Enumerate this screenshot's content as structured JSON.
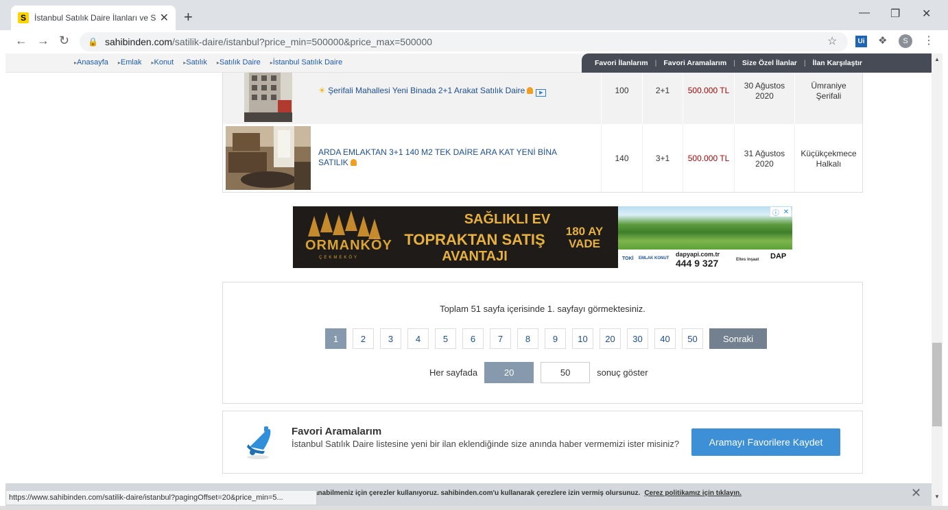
{
  "browser": {
    "tab_favicon": "S",
    "tab_title": "İstanbul Satılık Daire İlanları ve Sa",
    "tab_close": "✕",
    "new_tab": "+",
    "url_host": "sahibinden.com",
    "url_path": "/satilik-daire/istanbul?price_min=500000&price_max=500000",
    "ext_label": "Ui",
    "profile_initial": "S"
  },
  "breadcrumbs": [
    "Anasayfa",
    "Emlak",
    "Konut",
    "Satılık",
    "Satılık Daire",
    "İstanbul Satılık Daire"
  ],
  "favnav": [
    "Favori İlanlarım",
    "Favori Aramalarım",
    "Size Özel İlanlar",
    "İlan Karşılaştır"
  ],
  "listings": [
    {
      "title": "Şerifali Mahallesi Yeni Binada 2+1 Arakat Satılık Daire",
      "m2": "100",
      "rooms": "2+1",
      "price": "500.000 TL",
      "date_line1": "30 Ağustos",
      "date_line2": "2020",
      "loc_line1": "Ümraniye",
      "loc_line2": "Şerifali"
    },
    {
      "title": "ARDA EMLAKTAN 3+1 140 M2 TEK DAİRE ARA KAT YENİ BİNA SATILIK",
      "m2": "140",
      "rooms": "3+1",
      "price": "500.000 TL",
      "date_line1": "31 Ağustos",
      "date_line2": "2020",
      "loc_line1": "Küçükçekmece",
      "loc_line2": "Halkalı"
    }
  ],
  "ad": {
    "brand": "ORMANKÖY",
    "brand_sub": "ÇEKMEKÖY",
    "line1": "SAĞLIKLI EV",
    "line2": "TOPRAKTAN SATIŞ",
    "line3": "AVANTAJI",
    "vade1": "180 AY",
    "vade2": "VADE",
    "toki": "TOKİ",
    "emlak_konut": "EMLAK KONUT",
    "dap_url": "dapyapi.com.tr",
    "phone": "444 9 327",
    "eltes": "Eltes inşaat",
    "dp": "DAP"
  },
  "pagination": {
    "info": "Toplam 51 sayfa içerisinde 1. sayfayı görmektesiniz.",
    "pages": [
      "1",
      "2",
      "3",
      "4",
      "5",
      "6",
      "7",
      "8",
      "9",
      "10",
      "20",
      "30",
      "40",
      "50"
    ],
    "active_page": "1",
    "next_label": "Sonraki",
    "per_page_label": "Her sayfada",
    "per_page_options": [
      "20",
      "50"
    ],
    "per_page_selected": "20",
    "per_page_suffix": "sonuç göster"
  },
  "favorite_search": {
    "title": "Favori Aramalarım",
    "description": "İstanbul Satılık Daire listesine yeni bir ilan eklendiğinde size anında haber vermemizi ister misiniz?",
    "button": "Aramayı Favorilere Kaydet"
  },
  "cookie_bar": {
    "text": "anabilmeniz için çerezler kullanıyoruz. sahibinden.com'u kullanarak çerezlere izin vermiş olursunuz.",
    "link": "Çerez politikamız için tıklayın.",
    "close": "✕"
  },
  "status_url": "https://www.sahibinden.com/satilik-daire/istanbul?pagingOffset=20&price_min=5...",
  "colors": {
    "link_blue": "#1d4f91",
    "price_red": "#a00808",
    "active_page": "#8799ad",
    "save_button": "#3d8fd6",
    "favnav_bg": "#464b55"
  }
}
